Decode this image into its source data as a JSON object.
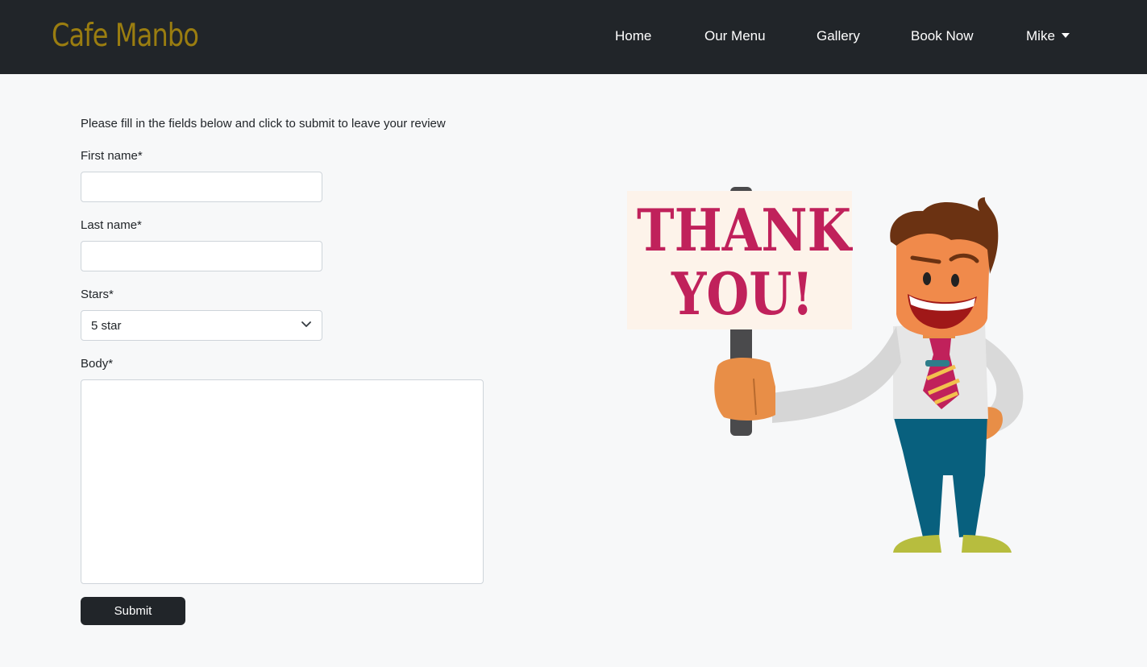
{
  "navbar": {
    "brand": "Cafe Manbo",
    "links": [
      "Home",
      "Our Menu",
      "Gallery",
      "Book Now"
    ],
    "user_menu": "Mike"
  },
  "form": {
    "intro": "Please fill in the fields below and click to submit to leave your review",
    "first_name_label": "First name*",
    "first_name_value": "",
    "last_name_label": "Last name*",
    "last_name_value": "",
    "stars_label": "Stars*",
    "stars_value": "5 star",
    "body_label": "Body*",
    "body_value": "",
    "submit_label": "Submit"
  },
  "illustration": {
    "sign_line1": "THANK",
    "sign_line2": "YOU!"
  },
  "colors": {
    "navbar_bg": "#212529",
    "brand": "#9a7d10",
    "page_bg": "#f7f8f9",
    "sign_text": "#c0215b",
    "button_bg": "#212529"
  }
}
